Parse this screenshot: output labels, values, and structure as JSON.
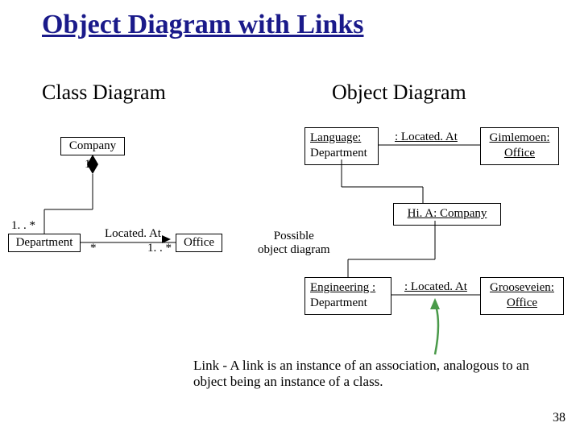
{
  "title": "Object Diagram with Links",
  "left": {
    "heading": "Class Diagram",
    "company": "Company",
    "department": "Department",
    "office": "Office",
    "assoc_located": "Located. At",
    "mult_one": "1",
    "mult_one_star_a": "1. . *",
    "mult_star": "*",
    "mult_one_star_b": "1. . *"
  },
  "right": {
    "heading": "Object Diagram",
    "lang_name": "Language:",
    "lang_cls": " Department",
    "link1": ": Located. At",
    "gim_name": "Gimlemoen:",
    "gim_cls": "Office",
    "hia_name": "Hi. A: Company",
    "possible": "Possible\nobject diagram",
    "eng_name": "Engineering :",
    "eng_cls": " Department",
    "link2": ": Located. At",
    "gro_name": "Grooseveien:",
    "gro_cls": "Office"
  },
  "footer": "Link - A link is an instance of an association, analogous to an object being an instance of a class.",
  "page": "38"
}
